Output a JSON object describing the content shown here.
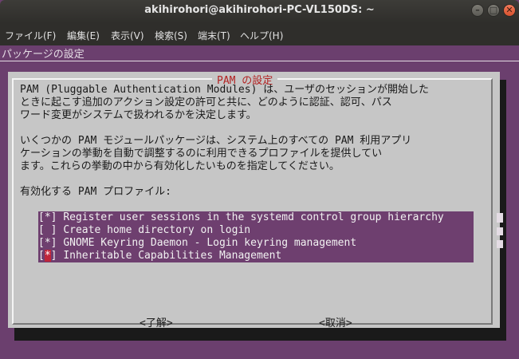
{
  "window": {
    "title": "akihirohori@akihirohori-PC-VL150DS: ~",
    "btn_min": "–",
    "btn_max": "□",
    "btn_close": "✕"
  },
  "menu": {
    "items": [
      "ファイル(F)",
      "編集(E)",
      "表示(V)",
      "検索(S)",
      "端末(T)",
      "ヘルプ(H)"
    ]
  },
  "terminal": {
    "backtitle": "パッケージの設定"
  },
  "dialog": {
    "title": "PAM の設定",
    "para1": [
      "PAM (Pluggable Authentication Modules) は、ユーザのセッションが開始した",
      "ときに起こす追加のアクション設定の許可と共に、どのように認証、認可、パス",
      "ワード変更がシステムで扱われるかを決定します。"
    ],
    "para2": [
      "いくつかの PAM モジュールパッケージは、システム上のすべての PAM 利用アプリ",
      "ケーションの挙動を自動で調整するのに利用できるプロファイルを提供してい",
      "ます。これらの挙動の中から有効化したいものを指定してください。"
    ],
    "prompt": "有効化する PAM プロファイル:",
    "profiles": [
      {
        "check": "[*]",
        "label": "Register user sessions in the systemd control group hierarchy"
      },
      {
        "check": "[ ]",
        "label": "Create home directory on login"
      },
      {
        "check": "[*]",
        "label": "GNOME Keyring Daemon - Login keyring management"
      },
      {
        "check": "[*]",
        "label": "Inheritable Capabilities Management"
      }
    ],
    "ok_label": "<了解>",
    "cancel_label": "<取消>"
  },
  "colors": {
    "terminal_bg": "#6b3f6e",
    "dialog_bg": "#c6c6c6",
    "title_red": "#b22222",
    "highlight_red": "#c0253a"
  }
}
